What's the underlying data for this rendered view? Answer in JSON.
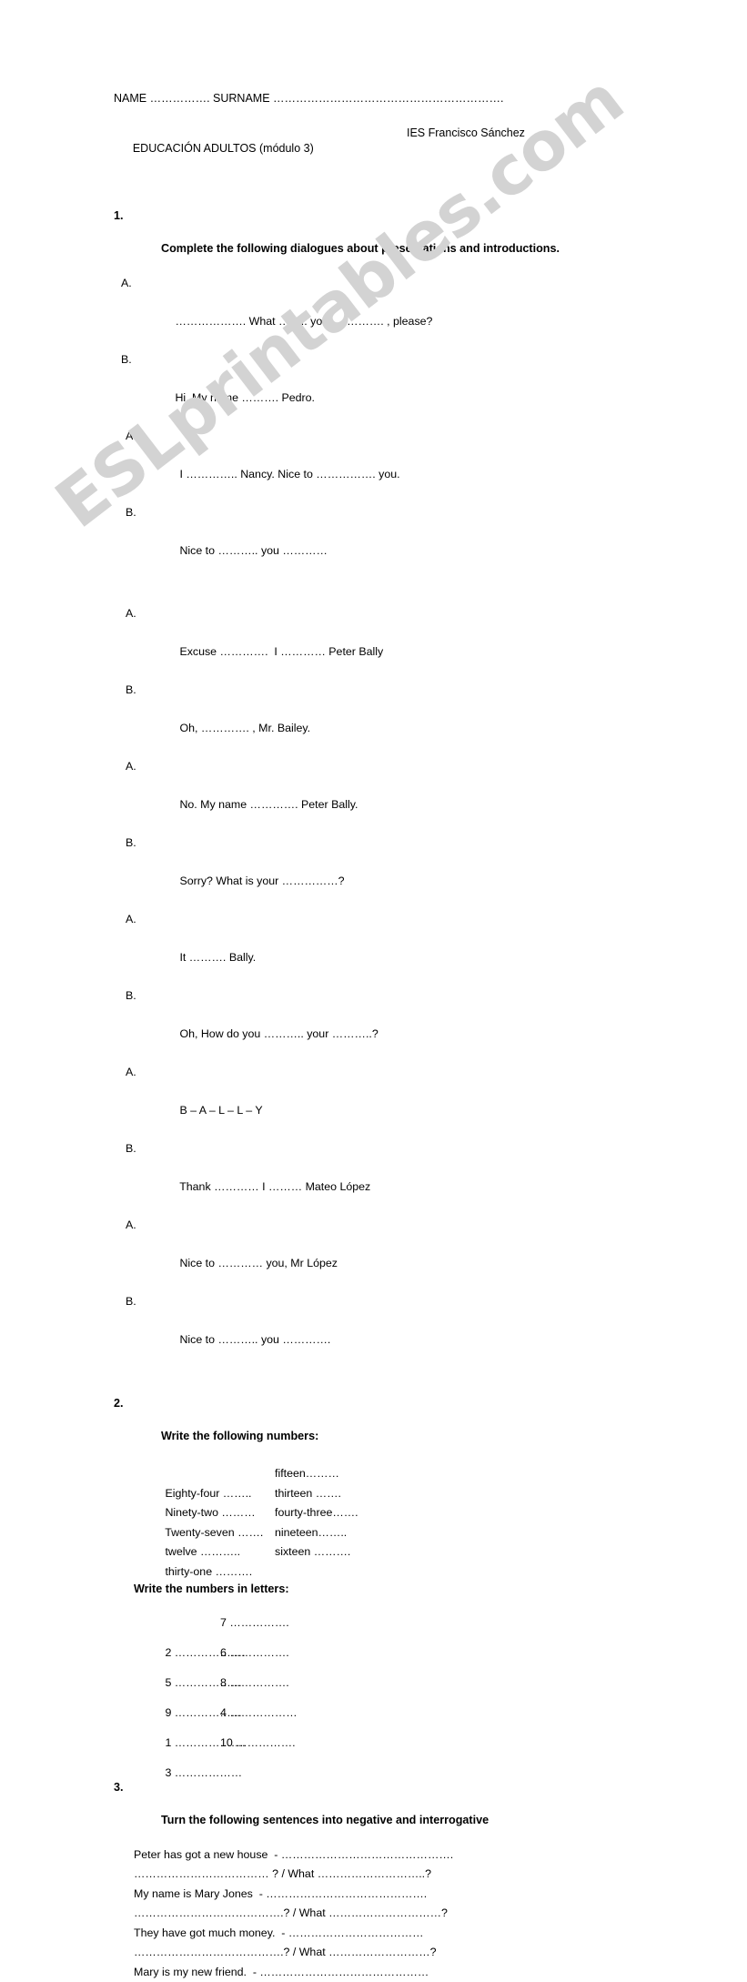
{
  "watermark": {
    "text": "ESLprintables.com",
    "color": "#d3d3d3"
  },
  "header": {
    "name_line": "NAME ……………. SURNAME …………………………………………………….",
    "course": "EDUCACIÓN ADULTOS (módulo 3)",
    "school": "IES Francisco Sánchez"
  },
  "exercises": [
    {
      "number": "1.",
      "title": "Complete the following dialogues about presentations and introductions.",
      "dialogue1": [
        {
          "speaker": "A.",
          "text": "………………. What …….. your …………. , please?",
          "indent": false
        },
        {
          "speaker": "B.",
          "text": "Hi, My name ………. Pedro.",
          "indent": false
        },
        {
          "speaker": "A.",
          "text": "I ………….. Nancy. Nice to ……………. you.",
          "indent": true
        },
        {
          "speaker": "B.",
          "text": "Nice to ……….. you …………",
          "indent": true
        }
      ],
      "dialogue2": [
        {
          "speaker": "A.",
          "text": "Excuse ………….  I ………… Peter Bally",
          "indent": true
        },
        {
          "speaker": "B.",
          "text": "Oh, …………. , Mr. Bailey.",
          "indent": true
        },
        {
          "speaker": "A.",
          "text": "No. My name …………. Peter Bally.",
          "indent": true
        },
        {
          "speaker": "B.",
          "text": "Sorry? What is your ……………?",
          "indent": true
        },
        {
          "speaker": "A.",
          "text": "It ………. Bally.",
          "indent": true
        },
        {
          "speaker": "B.",
          "text": "Oh, How do you ……….. your ………..?",
          "indent": true
        },
        {
          "speaker": "A.",
          "text": "B – A – L – L – Y",
          "indent": true
        },
        {
          "speaker": "B.",
          "text": "Thank ………… I ……… Mateo López",
          "indent": true
        },
        {
          "speaker": "A.",
          "text": "Nice to ………… you, Mr López",
          "indent": true
        },
        {
          "speaker": "B.",
          "text": "Nice to ……….. you ………….",
          "indent": true
        }
      ]
    },
    {
      "number": "2.",
      "title": "Write the following numbers:",
      "numbers": [
        {
          "left": "Eighty-four ……..",
          "right": "fifteen………"
        },
        {
          "left": "Ninety-two ………",
          "right": "thirteen ……."
        },
        {
          "left": "Twenty-seven …….",
          "right": "fourty-three……."
        },
        {
          "left": "twelve ………..",
          "right": "nineteen…….."
        },
        {
          "left": "thirty-one ……….",
          "right": "sixteen ………."
        }
      ],
      "sub_title": "Write the numbers in letters:",
      "letters": [
        {
          "left": "2 ……………….",
          "right": "7 ……………."
        },
        {
          "left": "5 ………………",
          "right": "6 ……………."
        },
        {
          "left": "9 ………………",
          "right": "8 ……………."
        },
        {
          "left": "1 ……………….",
          "right": "4 ………………"
        },
        {
          "left": "3 ………………",
          "right": "10 ……………."
        }
      ]
    },
    {
      "number": "3.",
      "title": "Turn the following sentences into negative and interrogative",
      "sentences": [
        "Peter has got a new house  - ……………………………………….",
        "……………………………… ? / What ………………………..?",
        "My name is Mary Jones  - …………………………………….",
        "………………………………….? / What …………………………?",
        "They have got much money.  - ………………………………",
        "………………………………….? / What ………………………?",
        "Mary is my new friend.  - ………………………………………"
      ]
    }
  ]
}
